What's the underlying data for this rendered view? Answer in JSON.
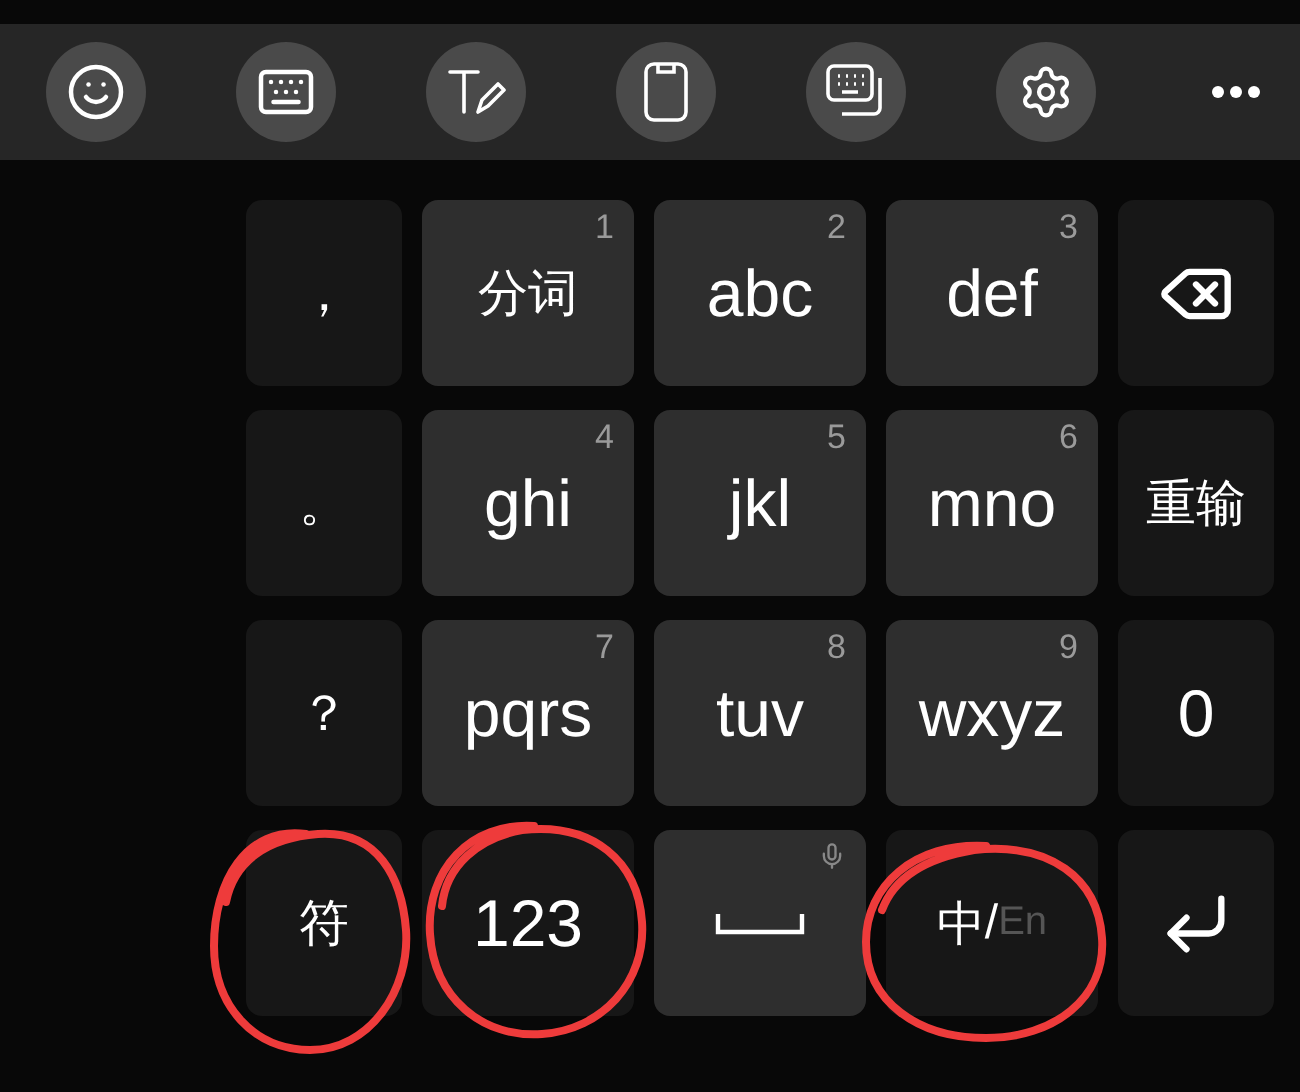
{
  "toolbar": {
    "buttons": [
      {
        "kind": "emoji"
      },
      {
        "kind": "keyboard"
      },
      {
        "kind": "text-edit"
      },
      {
        "kind": "clipboard"
      },
      {
        "kind": "keyboard-mode"
      },
      {
        "kind": "settings"
      },
      {
        "kind": "more"
      }
    ]
  },
  "keys": [
    {
      "kind": "symbol",
      "label": "，",
      "circled": false
    },
    {
      "kind": "letter",
      "label": "分词",
      "number": "1",
      "circled": false
    },
    {
      "kind": "letter",
      "label": "abc",
      "number": "2",
      "circled": false
    },
    {
      "kind": "letter",
      "label": "def",
      "number": "3",
      "circled": false
    },
    {
      "kind": "backspace",
      "circled": false
    },
    {
      "kind": "symbol",
      "label": "。",
      "circled": false
    },
    {
      "kind": "letter",
      "label": "ghi",
      "number": "4",
      "circled": false
    },
    {
      "kind": "letter",
      "label": "jkl",
      "number": "5",
      "circled": false
    },
    {
      "kind": "letter",
      "label": "mno",
      "number": "6",
      "circled": false
    },
    {
      "kind": "symbol",
      "label": "重输",
      "circled": false
    },
    {
      "kind": "symbol",
      "label": "？",
      "circled": false
    },
    {
      "kind": "letter",
      "label": "pqrs",
      "number": "7",
      "circled": false
    },
    {
      "kind": "letter",
      "label": "tuv",
      "number": "8",
      "circled": false
    },
    {
      "kind": "letter",
      "label": "wxyz",
      "number": "9",
      "circled": false
    },
    {
      "kind": "symbol",
      "label": "0",
      "circled": false
    },
    {
      "kind": "symbol",
      "label": "符",
      "circled": true
    },
    {
      "kind": "symbol",
      "label": "123",
      "circled": true
    },
    {
      "kind": "space",
      "circled": false
    },
    {
      "kind": "lang",
      "options": [
        {
          "label": "中",
          "selected": true
        },
        {
          "label": "En",
          "selected": false
        }
      ],
      "separator": "/",
      "circled": true
    },
    {
      "kind": "enter",
      "circled": false
    }
  ]
}
